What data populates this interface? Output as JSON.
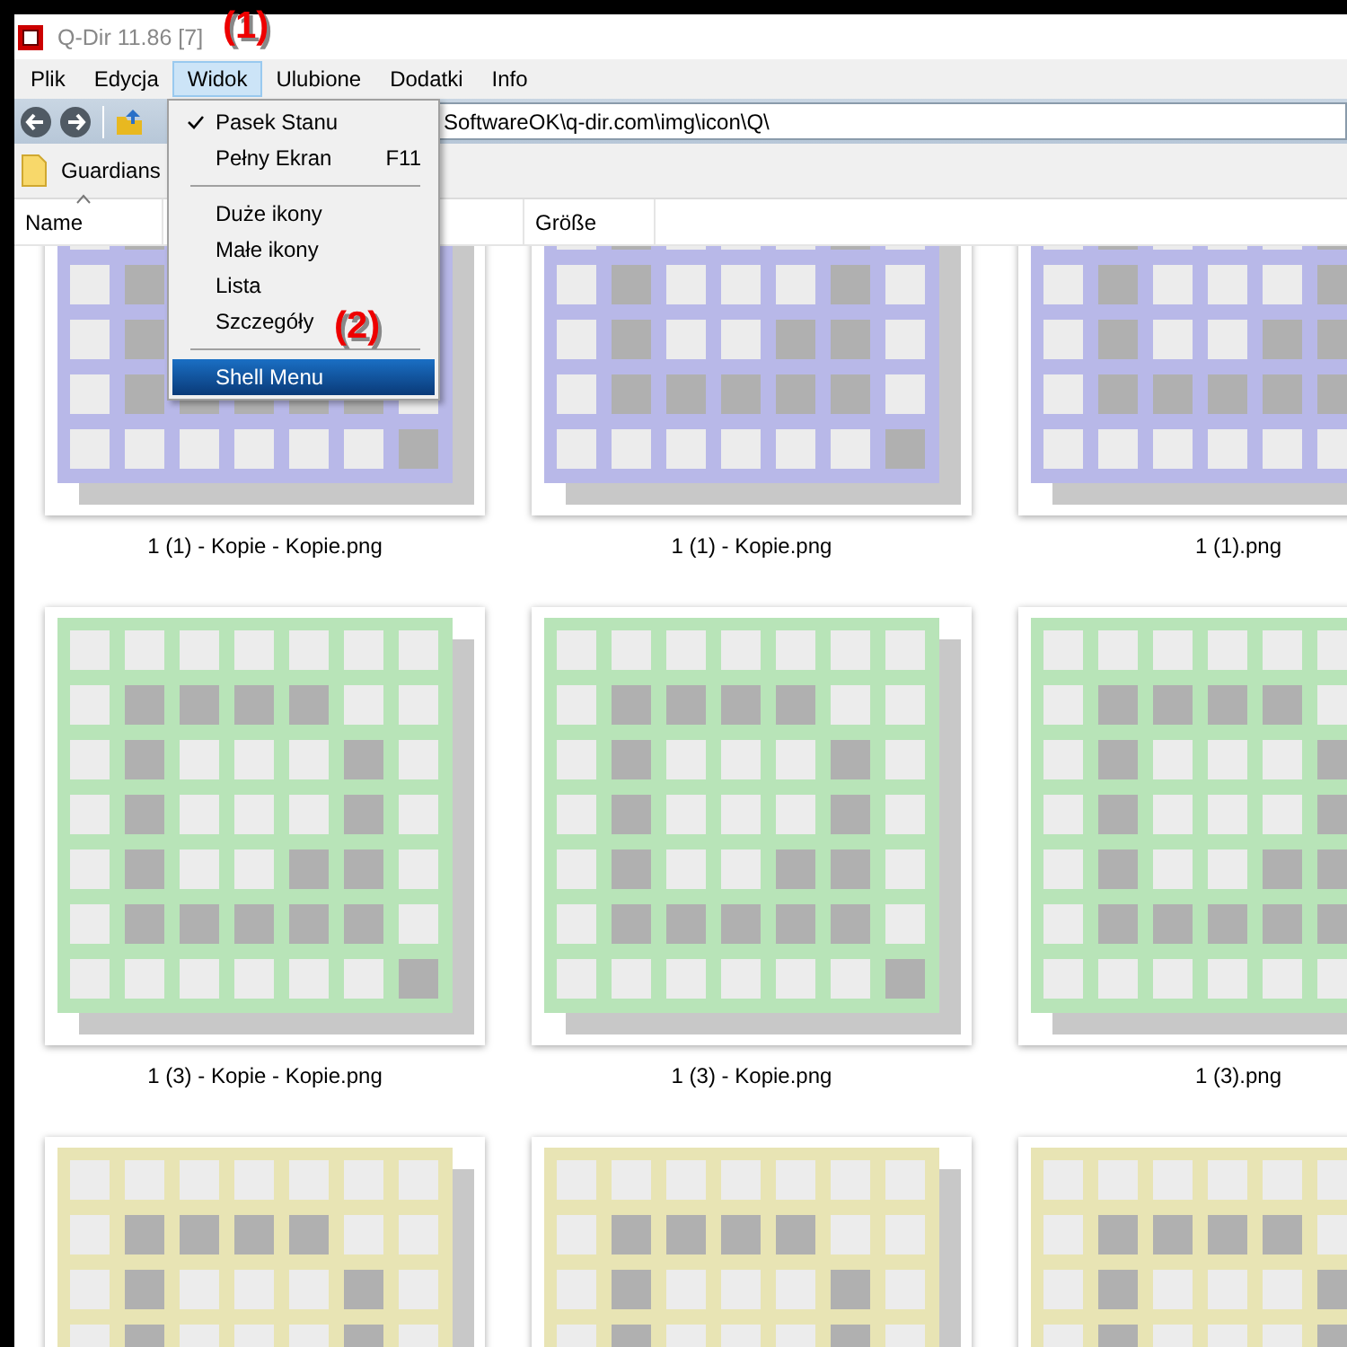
{
  "window": {
    "title": "Q-Dir 11.86 [7]"
  },
  "menu_bar": [
    {
      "label": "Plik",
      "selected": false
    },
    {
      "label": "Edycja",
      "selected": false
    },
    {
      "label": "Widok",
      "selected": true
    },
    {
      "label": "Ulubione",
      "selected": false
    },
    {
      "label": "Dodatki",
      "selected": false
    },
    {
      "label": "Info",
      "selected": false
    }
  ],
  "address_bar": {
    "value": "SoftwareOK\\q-dir.com\\img\\icon\\Q\\"
  },
  "favorites_bar": [
    {
      "label": "Guardians"
    }
  ],
  "columns": [
    {
      "label": "Name",
      "sorted": true
    },
    {
      "label": "Größe",
      "sorted": false
    }
  ],
  "dropdown_menu": [
    {
      "kind": "item",
      "label": "Pasek Stanu",
      "checked": true,
      "selected": false
    },
    {
      "kind": "item",
      "label": "Pełny Ekran",
      "shortcut": "F11",
      "checked": false,
      "selected": false
    },
    {
      "kind": "separator"
    },
    {
      "kind": "item",
      "label": "Duże ikony",
      "checked": false,
      "selected": false
    },
    {
      "kind": "item",
      "label": "Małe ikony",
      "checked": false,
      "selected": false
    },
    {
      "kind": "item",
      "label": "Lista",
      "checked": false,
      "selected": false
    },
    {
      "kind": "item",
      "label": "Szczegóły",
      "checked": false,
      "selected": false
    },
    {
      "kind": "separator"
    },
    {
      "kind": "item",
      "label": "Shell Menu",
      "checked": false,
      "selected": true
    }
  ],
  "files": [
    {
      "name": "1 (1) - Kopie - Kopie.png",
      "color": "#b8b8e8"
    },
    {
      "name": "1 (1) - Kopie.png",
      "color": "#b8b8e8"
    },
    {
      "name": "1 (1).png",
      "color": "#b8b8e8"
    },
    {
      "name": "1 (3) - Kopie - Kopie.png",
      "color": "#b8e4b8"
    },
    {
      "name": "1 (3) - Kopie.png",
      "color": "#b8e4b8"
    },
    {
      "name": "1 (3).png",
      "color": "#b8e4b8"
    },
    {
      "color": "#e8e4b4"
    },
    {
      "color": "#e8e4b4"
    },
    {
      "color": "#e8e4b4"
    }
  ],
  "annotations": [
    {
      "label": "(1)"
    },
    {
      "label": "(2)"
    }
  ]
}
